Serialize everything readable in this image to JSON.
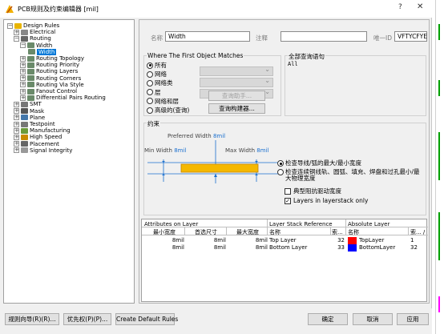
{
  "window": {
    "title": "PCB规则及约束编辑器 [mil]",
    "help": "?",
    "close": "✕"
  },
  "tree": {
    "items": [
      {
        "label": "Design Rules",
        "toggle": "⊟",
        "icon": "folder"
      },
      {
        "label": "Electrical",
        "toggle": "⊞",
        "icon": "electrical"
      },
      {
        "label": "Routing",
        "toggle": "⊟",
        "icon": "routing"
      },
      {
        "label": "Width",
        "toggle": "⊟",
        "icon": "rule"
      },
      {
        "label": "Width",
        "toggle": "",
        "icon": "rule"
      },
      {
        "label": "Routing Topology",
        "toggle": "⊞",
        "icon": "rule"
      },
      {
        "label": "Routing Priority",
        "toggle": "⊞",
        "icon": "rule"
      },
      {
        "label": "Routing Layers",
        "toggle": "⊞",
        "icon": "rule"
      },
      {
        "label": "Routing Corners",
        "toggle": "⊞",
        "icon": "rule"
      },
      {
        "label": "Routing Via Style",
        "toggle": "⊞",
        "icon": "rule"
      },
      {
        "label": "Fanout Control",
        "toggle": "⊞",
        "icon": "rule"
      },
      {
        "label": "Differential Pairs Routing",
        "toggle": "⊞",
        "icon": "rule"
      },
      {
        "label": "SMT",
        "toggle": "⊞",
        "icon": "smt"
      },
      {
        "label": "Mask",
        "toggle": "⊞",
        "icon": "mask"
      },
      {
        "label": "Plane",
        "toggle": "⊞",
        "icon": "plane"
      },
      {
        "label": "Testpoint",
        "toggle": "⊞",
        "icon": "testpoint"
      },
      {
        "label": "Manufacturing",
        "toggle": "⊞",
        "icon": "manufacturing"
      },
      {
        "label": "High Speed",
        "toggle": "⊞",
        "icon": "highspeed"
      },
      {
        "label": "Placement",
        "toggle": "⊞",
        "icon": "placement"
      },
      {
        "label": "Signal Integrity",
        "toggle": "⊞",
        "icon": "signal"
      }
    ]
  },
  "rule": {
    "name_label": "名称",
    "name_value": "Width",
    "comment_label": "注释",
    "comment_value": "",
    "uid_label": "唯一ID",
    "uid_value": "VFTYCFYE"
  },
  "match": {
    "title": "Where The First Object Matches",
    "options": [
      "所有",
      "网络",
      "网络类",
      "层",
      "网络和层",
      "高级的(查询)"
    ],
    "selected": 0,
    "query_helper": "查询助手...",
    "query_builder": "查询构建器..."
  },
  "full_query": {
    "title": "全部查询语句",
    "text": "All"
  },
  "constraints": {
    "title": "约束",
    "preferred_label": "Preferred Width",
    "preferred_value": "8mil",
    "min_label": "Min Width",
    "min_value": "8mil",
    "max_label": "Max Width",
    "max_value": "8mil",
    "check_opts": [
      "检查导线/弧的最大/最小宽度",
      "检查连续铜线轨、圆弧、填充、焊盘和过孔最小/最大物理宽度"
    ],
    "check_selected": 0,
    "impedance_label": "典型阻抗驱动宽度",
    "impedance_checked": false,
    "layers_only_label": "Layers in layerstack only",
    "layers_only_checked": true
  },
  "table": {
    "group_headers": [
      "Attributes on Layer",
      "Layer Stack Reference",
      "Absolute Layer"
    ],
    "columns": [
      "最小宽度",
      "首选尺寸",
      "最大宽度",
      "名称",
      "索...",
      "名称",
      "索... /"
    ],
    "rows": [
      {
        "min": "8mil",
        "pref": "8mil",
        "max": "8mil",
        "name": "Top Layer",
        "idx": "32",
        "abs_color": "#ff0000",
        "abs_name": "TopLayer",
        "abs_idx": "1"
      },
      {
        "min": "8mil",
        "pref": "8mil",
        "max": "8mil",
        "name": "Bottom Layer",
        "idx": "33",
        "abs_color": "#0000ff",
        "abs_name": "BottomLayer",
        "abs_idx": "32"
      }
    ]
  },
  "footer": {
    "wizard": "规则向导(R)(R)...",
    "priority": "优先权(P)(P)...",
    "create_defaults": "Create Default Rules",
    "ok": "确定",
    "cancel": "取消",
    "apply": "应用"
  }
}
